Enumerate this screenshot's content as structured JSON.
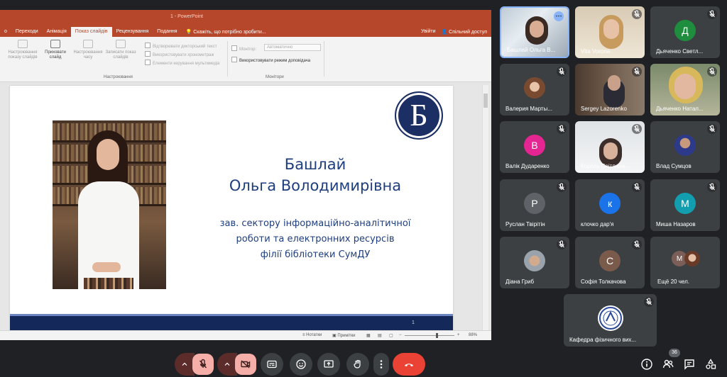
{
  "powerpoint": {
    "window_title": "1 - PowerPoint",
    "tabs": [
      "о",
      "Переходи",
      "Анімація",
      "Показ слайдів",
      "Рецензування",
      "Подання"
    ],
    "active_tab_index": 3,
    "tell_me": "Скажіть, що потрібно зробити...",
    "sign_in": "Увійти",
    "share": "Спільний доступ",
    "ribbon": {
      "btn_setup_show": "Настроювання показу слайдів",
      "btn_hide_slide": "Приховати слайд",
      "btn_rehearse": "Настроювання часу",
      "btn_record": "Записати показ слайдів",
      "chk_narrations": "Відтворювати дикторський текст",
      "chk_timings": "Використовувати хронометраж",
      "chk_media_controls": "Елементи керування мультимедіа",
      "group_setup": "Настроювання",
      "monitor_label": "Монітор:",
      "monitor_value": "Автоматично",
      "chk_presenter_view": "Використовувати режим доповідача",
      "group_monitors": "Монітори"
    },
    "slide": {
      "logo_letter": "Б",
      "name_line1": "Башлай",
      "name_line2": "Ольга Володимирівна",
      "position_line1": "зав. сектору інформаційно-аналітичної",
      "position_line2": "роботи та електронних ресурсів",
      "position_line3": "філії бібліотеки СумДУ",
      "page_number": "1"
    },
    "status": {
      "notes": "Нотатки",
      "comments": "Примітки",
      "zoom": "88%"
    }
  },
  "participants": [
    {
      "name": "Башлай Ольга В...",
      "speaking": true,
      "video": true
    },
    {
      "name": "Vita Vorona",
      "video": true
    },
    {
      "name": "Дьяченко Светл...",
      "initial": "Д",
      "color": "#1e8e3e"
    },
    {
      "name": "Валерия Марты...",
      "photo": true
    },
    {
      "name": "Sergey Lazorenko",
      "video": true
    },
    {
      "name": "Дьяченко Натал...",
      "video": true
    },
    {
      "name": "Валік Дударенко",
      "initial": "В",
      "color": "#e52592"
    },
    {
      "name": "Король Світлана...",
      "video": true
    },
    {
      "name": "Влад Сумцов",
      "photo": true
    },
    {
      "name": "Руслан Твірітін",
      "initial": "Р",
      "color": "#5f6368"
    },
    {
      "name": "клочко дар'я",
      "initial": "к",
      "color": "#1a73e8"
    },
    {
      "name": "Миша Назаров",
      "initial": "М",
      "color": "#129eaf"
    },
    {
      "name": "Діана Гриб",
      "photo": true
    },
    {
      "name": "Софія Толкачова",
      "initial": "С",
      "color": "#7a5a4a"
    },
    {
      "name": "Ещё 20 чел.",
      "initial": "М",
      "color": "#7b5e57"
    },
    {
      "name": "Кафедра фізичного вих...",
      "logo": true
    }
  ],
  "more_options_label": "⋯",
  "participant_count": "36"
}
